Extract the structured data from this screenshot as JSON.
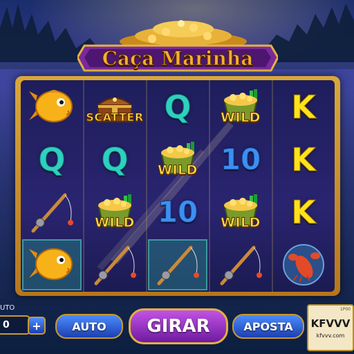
{
  "game": {
    "title": "Caça Marinha"
  },
  "reels": {
    "grid": [
      [
        {
          "symbol": "goldfish-icon",
          "label": ""
        },
        {
          "symbol": "treasure-chest-icon",
          "label": "SCATTER"
        },
        {
          "symbol": "letter-q",
          "label": "Q"
        },
        {
          "symbol": "coin-bucket-icon",
          "label": "WILD"
        },
        {
          "symbol": "letter-k",
          "label": "K"
        }
      ],
      [
        {
          "symbol": "letter-q",
          "label": "Q"
        },
        {
          "symbol": "letter-q",
          "label": "Q"
        },
        {
          "symbol": "coin-bucket-icon",
          "label": "WILD"
        },
        {
          "symbol": "number-ten",
          "label": "10"
        },
        {
          "symbol": "letter-k",
          "label": "K"
        }
      ],
      [
        {
          "symbol": "fishing-rod-icon",
          "label": ""
        },
        {
          "symbol": "coin-bucket-icon",
          "label": "WILD"
        },
        {
          "symbol": "number-ten",
          "label": "10"
        },
        {
          "symbol": "coin-bucket-icon",
          "label": "WILD"
        },
        {
          "symbol": "letter-k",
          "label": "K"
        }
      ],
      [
        {
          "symbol": "goldfish-icon",
          "label": ""
        },
        {
          "symbol": "fishing-rod-icon",
          "label": ""
        },
        {
          "symbol": "fishing-rod-icon",
          "label": ""
        },
        {
          "symbol": "fishing-rod-icon",
          "label": ""
        },
        {
          "symbol": "lobster-icon",
          "label": ""
        }
      ]
    ]
  },
  "controls": {
    "auto_field_label": "UTO",
    "auto_field_value": "0",
    "plus_label": "+",
    "auto_button": "AUTO",
    "spin_button": "GIRAR",
    "bet_button": "APOSTA"
  },
  "watermark": {
    "brand": "KFVVV",
    "url": "kfvvv.com",
    "tag": "1P00"
  },
  "colors": {
    "frame_gold": "#d9a73a",
    "reel_background": "#2a2470",
    "letter_q": "#2fd0c0",
    "letter_k": "#ffe21a",
    "number_ten": "#3e8ff0",
    "spin_button": "#9b3bd0",
    "side_buttons": "#2d5fe0"
  }
}
